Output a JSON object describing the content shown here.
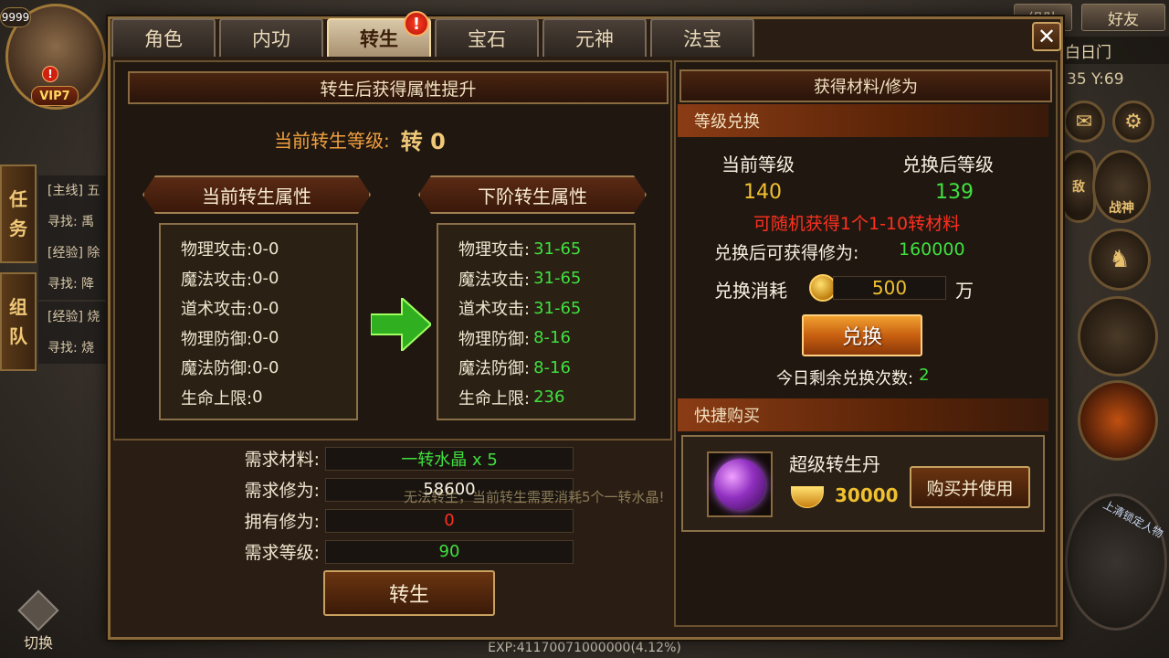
{
  "hud": {
    "level": "9999",
    "vip": "VIP7",
    "alert": "!",
    "side_tabs": [
      {
        "label_top": "任",
        "label_bottom": "务"
      },
      {
        "label_top": "组",
        "label_bottom": "队"
      }
    ],
    "quests": [
      "[主线] 五",
      "寻找: 禹",
      "[经验] 除",
      "寻找: 降",
      "[经验] 烧",
      "寻找: 烧"
    ],
    "top_buttons": [
      "组队",
      "好友"
    ],
    "location": "白日门",
    "coord": "35 Y:69",
    "right_icons": {
      "chat": "敌",
      "god": "战神"
    },
    "lock_hint": "上清锁定人物",
    "switch_label": "切换",
    "exp": "EXP:41170071000000(4.12%)"
  },
  "tabs": [
    {
      "label": "角色",
      "active": false
    },
    {
      "label": "内功",
      "active": false
    },
    {
      "label": "转生",
      "active": true
    },
    {
      "label": "宝石",
      "active": false
    },
    {
      "label": "元神",
      "active": false
    },
    {
      "label": "法宝",
      "active": false
    }
  ],
  "tab_badge": "!",
  "close_label": "✕",
  "left": {
    "header": "转生后获得属性提升",
    "current_level_label": "当前转生等级:",
    "current_level_value": "转 0",
    "current_title": "当前转生属性",
    "next_title": "下阶转生属性",
    "current_attrs": [
      {
        "label": "物理攻击:",
        "value": "0-0"
      },
      {
        "label": "魔法攻击:",
        "value": "0-0"
      },
      {
        "label": "道术攻击:",
        "value": "0-0"
      },
      {
        "label": "物理防御:",
        "value": "0-0"
      },
      {
        "label": "魔法防御:",
        "value": "0-0"
      },
      {
        "label": "生命上限:",
        "value": "0"
      }
    ],
    "next_attrs": [
      {
        "label": "物理攻击:",
        "value": "31-65"
      },
      {
        "label": "魔法攻击:",
        "value": "31-65"
      },
      {
        "label": "道术攻击:",
        "value": "31-65"
      },
      {
        "label": "物理防御:",
        "value": "8-16"
      },
      {
        "label": "魔法防御:",
        "value": "8-16"
      },
      {
        "label": "生命上限:",
        "value": "236"
      }
    ],
    "requirements": [
      {
        "label": "需求材料:",
        "value": "一转水晶 x 5",
        "color": "#40e040"
      },
      {
        "label": "需求修为:",
        "value": "58600",
        "color": "#f8f0e0"
      },
      {
        "label": "拥有修为:",
        "value": "0",
        "color": "#ff3020"
      },
      {
        "label": "需求等级:",
        "value": "90",
        "color": "#40e040"
      }
    ],
    "warning": "无法转生，当前转生需要消耗5个一转水晶!",
    "rebirth_button": "转生"
  },
  "right": {
    "header": "获得材料/修为",
    "exchange_section": "等级兑换",
    "current_level_label": "当前等级",
    "after_level_label": "兑换后等级",
    "current_level_value": "140",
    "after_level_value": "139",
    "random_hint": "可随机获得1个1-10转材料",
    "cultivation_label": "兑换后可获得修为:",
    "cultivation_value": "160000",
    "cost_label": "兑换消耗",
    "cost_value": "500",
    "cost_unit": "万",
    "exchange_button": "兑换",
    "remaining_label": "今日剩余兑换次数:",
    "remaining_value": "2",
    "quick_buy_section": "快捷购买",
    "item_name": "超级转生丹",
    "item_price": "30000",
    "buy_button": "购买并使用"
  },
  "colors": {
    "accent_gold": "#f0c030",
    "green": "#40e040",
    "red": "#ff3020",
    "orange_text": "#f0a040"
  }
}
